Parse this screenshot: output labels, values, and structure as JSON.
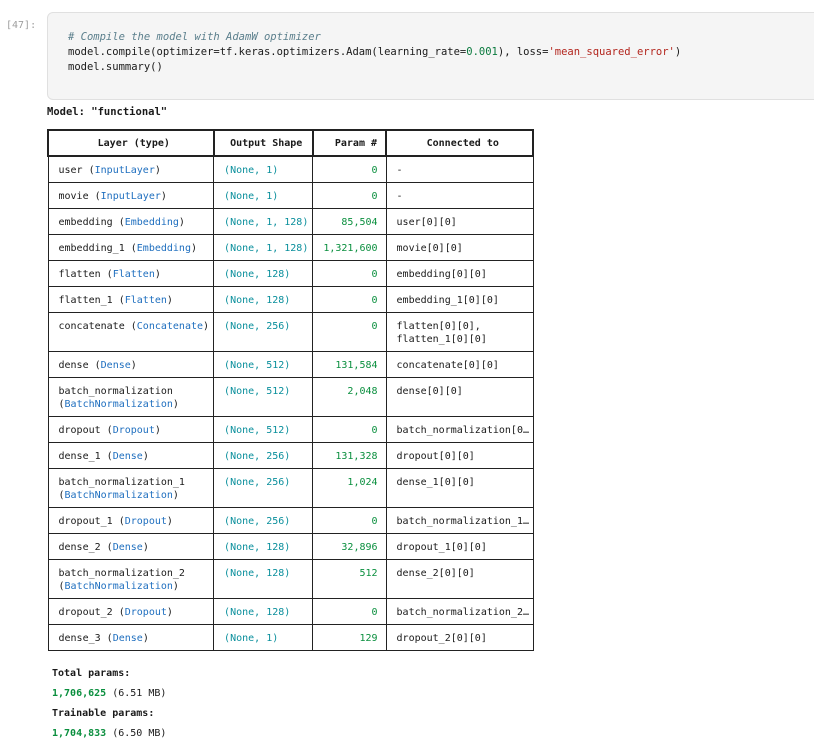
{
  "cell": {
    "prompt": "[47]:",
    "code_line1": "# Compile the model with AdamW optimizer",
    "code_line2_a": "model.compile(optimizer=tf.keras.optimizers.Adam(learning_rate=",
    "code_line2_num": "0.001",
    "code_line2_b": "), loss=",
    "code_line2_str": "'mean_squared_error'",
    "code_line2_c": ")",
    "code_line3": "model.summary()"
  },
  "summary": {
    "model_title": "Model: \"functional\"",
    "headers": [
      "Layer (type)",
      "Output Shape",
      "Param #",
      "Connected to"
    ],
    "rows": [
      {
        "name": "user",
        "type": "InputLayer",
        "type2": "",
        "shape": "(None, 1)",
        "params": "0",
        "conn": "-",
        "conn2": ""
      },
      {
        "name": "movie",
        "type": "InputLayer",
        "type2": "",
        "shape": "(None, 1)",
        "params": "0",
        "conn": "-",
        "conn2": ""
      },
      {
        "name": "embedding",
        "type": "Embedding",
        "type2": "",
        "shape": "(None, 1, 128)",
        "params": "85,504",
        "conn": "user[0][0]",
        "conn2": ""
      },
      {
        "name": "embedding_1",
        "type": "Embedding",
        "type2": "",
        "shape": "(None, 1, 128)",
        "params": "1,321,600",
        "conn": "movie[0][0]",
        "conn2": ""
      },
      {
        "name": "flatten",
        "type": "Flatten",
        "type2": "",
        "shape": "(None, 128)",
        "params": "0",
        "conn": "embedding[0][0]",
        "conn2": ""
      },
      {
        "name": "flatten_1",
        "type": "Flatten",
        "type2": "",
        "shape": "(None, 128)",
        "params": "0",
        "conn": "embedding_1[0][0]",
        "conn2": ""
      },
      {
        "name": "concatenate",
        "type": "Concatenate",
        "type2": "",
        "shape": "(None, 256)",
        "params": "0",
        "conn": "flatten[0][0],",
        "conn2": "flatten_1[0][0]"
      },
      {
        "name": "dense",
        "type": "Dense",
        "type2": "",
        "shape": "(None, 512)",
        "params": "131,584",
        "conn": "concatenate[0][0]",
        "conn2": ""
      },
      {
        "name": "batch_normalization",
        "type": "",
        "type2": "BatchNormalization",
        "shape": "(None, 512)",
        "params": "2,048",
        "conn": "dense[0][0]",
        "conn2": ""
      },
      {
        "name": "dropout",
        "type": "Dropout",
        "type2": "",
        "shape": "(None, 512)",
        "params": "0",
        "conn": "batch_normalization[0…",
        "conn2": ""
      },
      {
        "name": "dense_1",
        "type": "Dense",
        "type2": "",
        "shape": "(None, 256)",
        "params": "131,328",
        "conn": "dropout[0][0]",
        "conn2": ""
      },
      {
        "name": "batch_normalization_1",
        "type": "",
        "type2": "BatchNormalization",
        "shape": "(None, 256)",
        "params": "1,024",
        "conn": "dense_1[0][0]",
        "conn2": ""
      },
      {
        "name": "dropout_1",
        "type": "Dropout",
        "type2": "",
        "shape": "(None, 256)",
        "params": "0",
        "conn": "batch_normalization_1…",
        "conn2": ""
      },
      {
        "name": "dense_2",
        "type": "Dense",
        "type2": "",
        "shape": "(None, 128)",
        "params": "32,896",
        "conn": "dropout_1[0][0]",
        "conn2": ""
      },
      {
        "name": "batch_normalization_2",
        "type": "",
        "type2": "BatchNormalization",
        "shape": "(None, 128)",
        "params": "512",
        "conn": "dense_2[0][0]",
        "conn2": ""
      },
      {
        "name": "dropout_2",
        "type": "Dropout",
        "type2": "",
        "shape": "(None, 128)",
        "params": "0",
        "conn": "batch_normalization_2…",
        "conn2": ""
      },
      {
        "name": "dense_3",
        "type": "Dense",
        "type2": "",
        "shape": "(None, 1)",
        "params": "129",
        "conn": "dropout_2[0][0]",
        "conn2": ""
      }
    ],
    "total_label": "Total params:",
    "total_value": "1,706,625",
    "total_mb": "(6.51 MB)",
    "trainable_label": "Trainable params:",
    "trainable_value": "1,704,833",
    "trainable_mb": "(6.50 MB)"
  }
}
